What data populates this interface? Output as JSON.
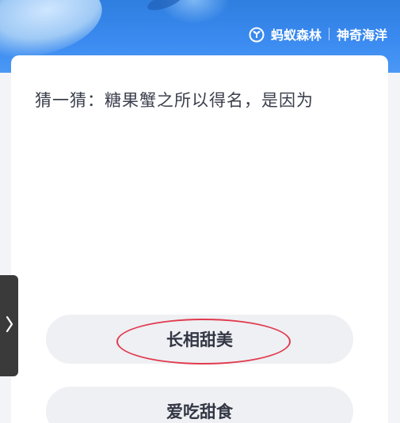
{
  "header": {
    "brand_name": "蚂蚁森林",
    "section_name": "神奇海洋",
    "logo_icon": "sprout-icon"
  },
  "quiz": {
    "question": "猜一猜：糖果蟹之所以得名，是因为",
    "options": [
      {
        "label": "长相甜美",
        "highlighted": true
      },
      {
        "label": "爱吃甜食",
        "highlighted": false
      }
    ],
    "highlight_color": "#e23a4f"
  },
  "side_tab": {
    "icon": "chevron-right-icon"
  },
  "colors": {
    "header_blue": "#3a8af0",
    "card_bg": "#ffffff",
    "option_bg": "#eef0f3",
    "question_text": "#3b3f4c"
  }
}
